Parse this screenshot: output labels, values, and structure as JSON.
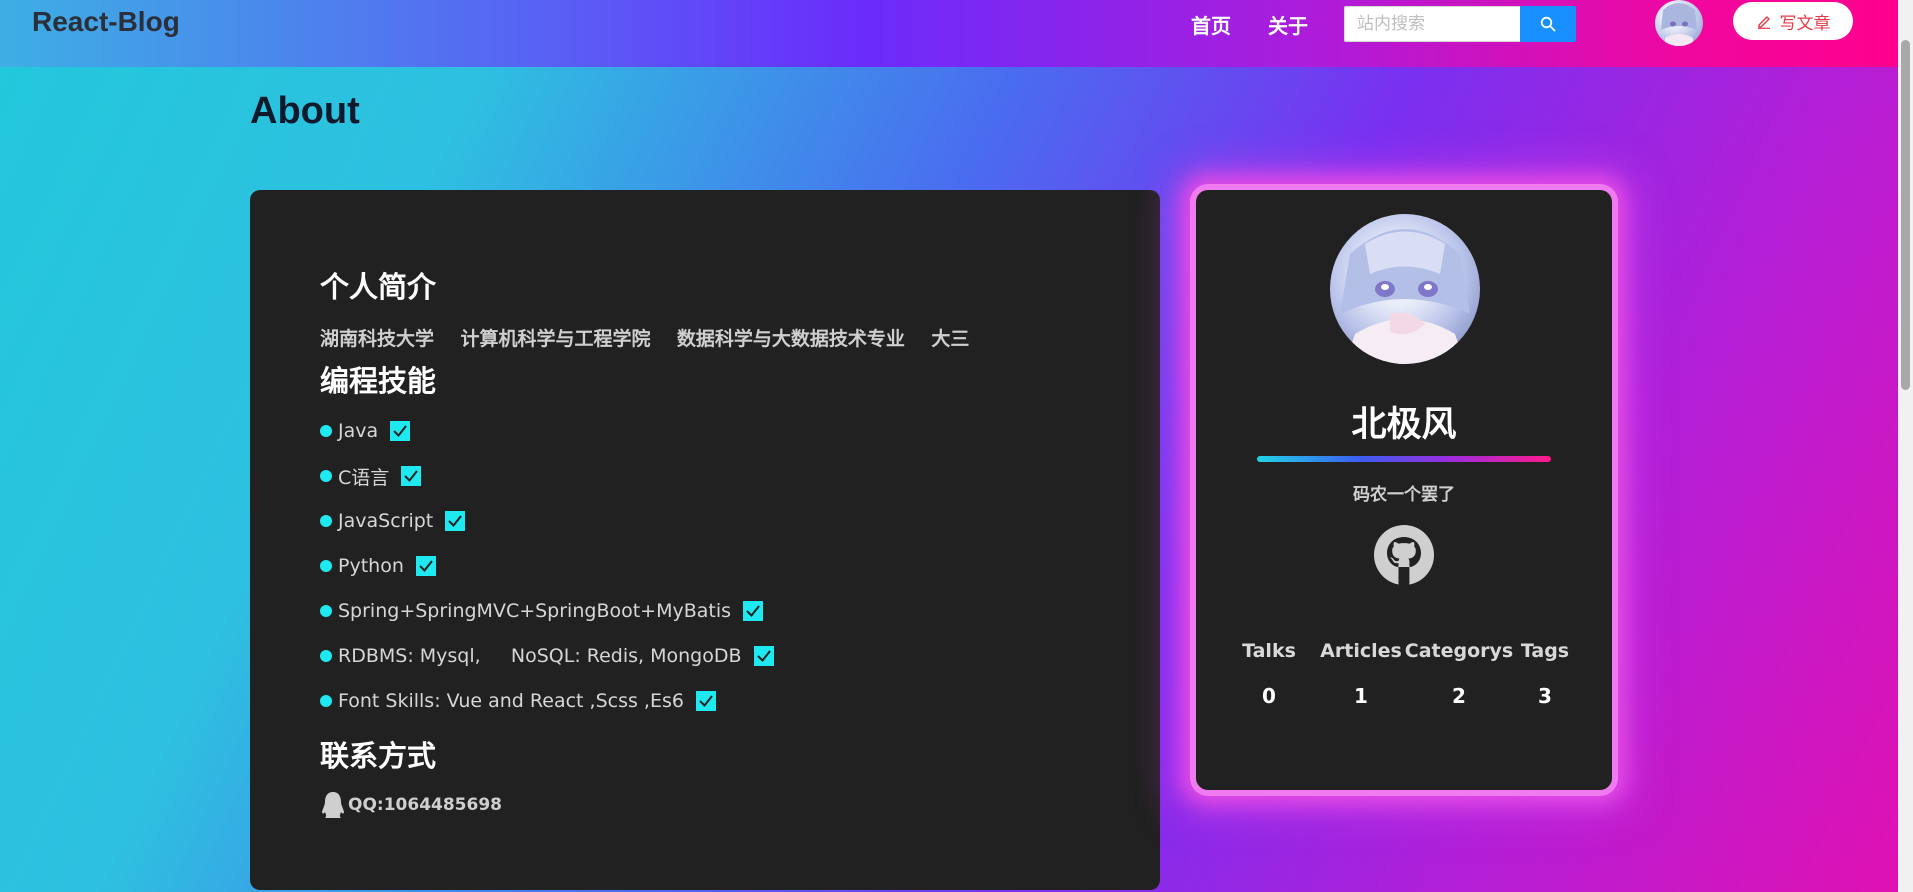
{
  "header": {
    "logo": "React-Blog",
    "nav": [
      {
        "label": "首页"
      },
      {
        "label": "关于"
      }
    ],
    "search": {
      "placeholder": "站内搜索",
      "value": ""
    },
    "write_label": "写文章",
    "icons": {
      "search": "search-icon",
      "write": "edit-icon"
    }
  },
  "page": {
    "title": "About"
  },
  "about": {
    "intro_title": "个人简介",
    "intro_text": "湖南科技大学    计算机科学与工程学院    数据科学与大数据技术专业    大三",
    "skills_title": "编程技能",
    "skills": [
      {
        "label": "Java"
      },
      {
        "label": "C语言"
      },
      {
        "label": "JavaScript"
      },
      {
        "label": "Python"
      },
      {
        "label": "Spring+SpringMVC+SpringBoot+MyBatis"
      },
      {
        "label": "RDBMS: Mysql,     NoSQL: Redis, MongoDB"
      },
      {
        "label": "Font Skills: Vue and React ,Scss ,Es6"
      }
    ],
    "contact_title": "联系方式",
    "contact_qq": "QQ:1064485698"
  },
  "profile": {
    "name": "北极风",
    "motto": "码农一个罢了",
    "stats": [
      {
        "label": "Talks",
        "value": "0"
      },
      {
        "label": "Articles",
        "value": "1"
      },
      {
        "label": "Categorys",
        "value": "2"
      },
      {
        "label": "Tags",
        "value": "3"
      }
    ]
  },
  "colors": {
    "accent_cyan": "#1ee8f0",
    "search_button": "#1890ff",
    "write_text": "#e8394a",
    "card_bg": "#212121",
    "glow": "#f07bf0"
  }
}
